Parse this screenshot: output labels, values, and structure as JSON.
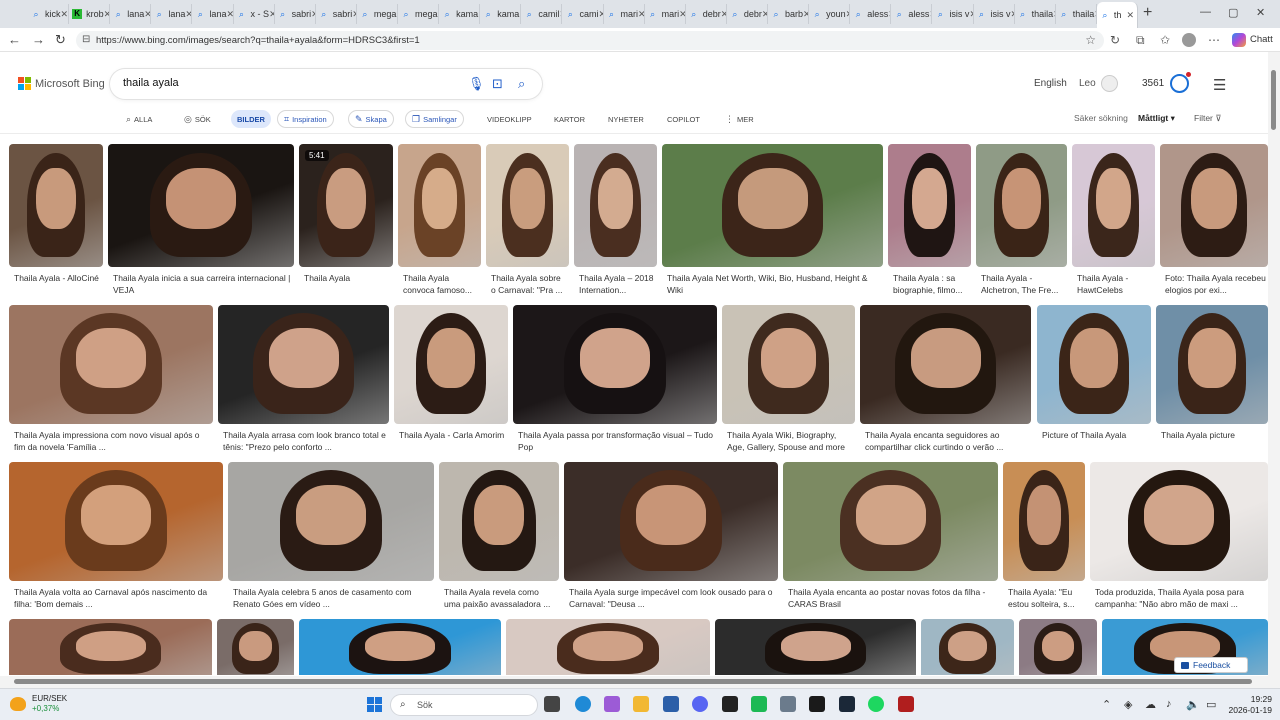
{
  "browser": {
    "tabs": [
      {
        "label": "kick",
        "fav": "search-icon"
      },
      {
        "label": "krob",
        "fav": "k-icon"
      },
      {
        "label": "lana",
        "fav": "search-icon"
      },
      {
        "label": "lana",
        "fav": "search-icon"
      },
      {
        "label": "lana",
        "fav": "search-icon"
      },
      {
        "label": "x - S",
        "fav": "search-icon"
      },
      {
        "label": "sabri",
        "fav": "search-icon"
      },
      {
        "label": "sabri",
        "fav": "search-icon"
      },
      {
        "label": "mega",
        "fav": "search-icon"
      },
      {
        "label": "mega",
        "fav": "search-icon"
      },
      {
        "label": "kama",
        "fav": "search-icon"
      },
      {
        "label": "kama",
        "fav": "search-icon"
      },
      {
        "label": "camil",
        "fav": "search-icon"
      },
      {
        "label": "cami",
        "fav": "search-icon"
      },
      {
        "label": "mari",
        "fav": "search-icon"
      },
      {
        "label": "mari",
        "fav": "search-icon"
      },
      {
        "label": "debr",
        "fav": "search-icon"
      },
      {
        "label": "debr",
        "fav": "search-icon"
      },
      {
        "label": "barb",
        "fav": "search-icon"
      },
      {
        "label": "youn",
        "fav": "search-icon"
      },
      {
        "label": "aless",
        "fav": "search-icon"
      },
      {
        "label": "aless",
        "fav": "search-icon"
      },
      {
        "label": "isis v",
        "fav": "search-icon"
      },
      {
        "label": "isis v",
        "fav": "search-icon"
      },
      {
        "label": "thaila",
        "fav": "search-icon"
      },
      {
        "label": "thaila",
        "fav": "search-icon"
      },
      {
        "label": "th",
        "fav": "search-icon",
        "active": true
      }
    ],
    "new_tab": "+",
    "url": "https://www.bing.com/images/search?q=thaila+ayala&form=HDRSC3&first=1",
    "chat_label": "Chatt"
  },
  "bing": {
    "logo_text": "Microsoft Bing",
    "query": "thaila ayala",
    "language": "English",
    "user_name": "Leo",
    "points": "3561",
    "scopes": [
      {
        "label": "ALLA",
        "icon": "search-icon",
        "style": "plain"
      },
      {
        "label": "SÖK",
        "icon": "copilot-icon",
        "style": "plain"
      },
      {
        "label": "BILDER",
        "icon": "",
        "style": "active"
      },
      {
        "label": "Inspiration",
        "icon": "inspiration-icon",
        "style": "pill"
      },
      {
        "label": "Skapa",
        "icon": "create-icon",
        "style": "pill"
      },
      {
        "label": "Samlingar",
        "icon": "collections-icon",
        "style": "pill"
      },
      {
        "label": "VIDEOKLIPP",
        "icon": "",
        "style": "plain"
      },
      {
        "label": "KARTOR",
        "icon": "",
        "style": "plain"
      },
      {
        "label": "NYHETER",
        "icon": "",
        "style": "plain"
      },
      {
        "label": "COPILOT",
        "icon": "",
        "style": "plain"
      },
      {
        "label": "MER",
        "icon": "more-icon",
        "style": "plain"
      }
    ],
    "safe_search_label": "Säker sökning",
    "safe_search_value": "Måttligt",
    "filter_label": "Filter"
  },
  "results": [
    {
      "caption": "Thaila Ayala - AlloCiné",
      "bg": "#6b5443",
      "skin": "#c89a7c",
      "hair": "#3a2418"
    },
    {
      "caption": "Thaila Ayala inicia a sua carreira internacional | VEJA",
      "bg": "#1a1512",
      "skin": "#c59275",
      "hair": "#2a1a12"
    },
    {
      "caption": "Thaila Ayala",
      "bg": "#2b221d",
      "skin": "#c99c80",
      "hair": "#3b2419",
      "badge": "5:41"
    },
    {
      "caption": "Thaila Ayala convoca famoso...",
      "bg": "#c7a58c",
      "skin": "#d6ac8a",
      "hair": "#6a4226"
    },
    {
      "caption": "Thaila Ayala sobre o Carnaval: \"Pra ...",
      "bg": "#d9cbb8",
      "skin": "#c99d7e",
      "hair": "#4b2f1f"
    },
    {
      "caption": "Thaila Ayala – 2018 Internation...",
      "bg": "#b9b3b3",
      "skin": "#d3ab90",
      "hair": "#4a2e20"
    },
    {
      "caption": "Thaila Ayala Net Worth, Wiki, Bio, Husband, Height & Wiki",
      "bg": "#5c7d4a",
      "skin": "#c59a7c",
      "hair": "#3c2519"
    },
    {
      "caption": "Thaila Ayala : sa biographie, filmo...",
      "bg": "#ad7d8c",
      "skin": "#d4a890",
      "hair": "#1f1513"
    },
    {
      "caption": "Thaila Ayala - Alchetron, The Fre...",
      "bg": "#8f9b86",
      "skin": "#c79476",
      "hair": "#3a2417"
    },
    {
      "caption": "Thaila Ayala - HawtCelebs",
      "bg": "#d7c8d6",
      "skin": "#d2a68a",
      "hair": "#3b261b"
    },
    {
      "caption": "Foto: Thaila Ayala recebeu elogios por exi...",
      "bg": "#b0968a",
      "skin": "#c89a7d",
      "hair": "#2d1c14"
    },
    {
      "caption": "Thaila Ayala impressiona com novo visual após o fim da novela 'Família ...",
      "bg": "#9c7561",
      "skin": "#cfa085",
      "hair": "#5b3724"
    },
    {
      "caption": "Thaila Ayala arrasa com look branco total e tênis: \"Prezo pelo conforto ...",
      "bg": "#252525",
      "skin": "#cfa28a",
      "hair": "#3a241a"
    },
    {
      "caption": "Thaila Ayala - Carla Amorim",
      "bg": "#ddd6d0",
      "skin": "#c99b7d",
      "hair": "#2c1c15"
    },
    {
      "caption": "Thaila Ayala passa por transformação visual – Tudo Pop",
      "bg": "#1c1718",
      "skin": "#d0a38b",
      "hair": "#161112"
    },
    {
      "caption": "Thaila Ayala Wiki, Biography, Age, Gallery, Spouse and more",
      "bg": "#c9c2b6",
      "skin": "#cfa186",
      "hair": "#3f2a1e"
    },
    {
      "caption": "Thaila Ayala encanta seguidores ao compartilhar click curtindo o verão ...",
      "bg": "#3a2a22",
      "skin": "#c89b80",
      "hair": "#22170f"
    },
    {
      "caption": "Picture of Thaila Ayala",
      "bg": "#8eb5cf",
      "skin": "#c8987a",
      "hair": "#3b2518"
    },
    {
      "caption": "Thaila Ayala picture",
      "bg": "#6f8fa7",
      "skin": "#cc9c7e",
      "hair": "#3a2418"
    },
    {
      "caption": "Thaila Ayala volta ao Carnaval após nascimento da filha: 'Bom demais ...",
      "bg": "#b5652e",
      "skin": "#d3a07c",
      "hair": "#6a3b1c"
    },
    {
      "caption": "Thaila Ayala celebra 5 anos de casamento com Renato Góes em vídeo ...",
      "bg": "#a7a6a3",
      "skin": "#c99d80",
      "hair": "#2a1b14"
    },
    {
      "caption": "Thaila Ayala revela como uma paixão avassaladora ...",
      "bg": "#bdb7ae",
      "skin": "#c99b7d",
      "hair": "#241812"
    },
    {
      "caption": "Thaila Ayala surge impecável com look ousado para o Carnaval: \"Deusa ...",
      "bg": "#3b2d28",
      "skin": "#c89577",
      "hair": "#4a2b1b"
    },
    {
      "caption": "Thaila Ayala encanta ao postar novas fotos da filha - CARAS Brasil",
      "bg": "#7c8a62",
      "skin": "#d1a487",
      "hair": "#4b3022"
    },
    {
      "caption": "Thaila Ayala: \"Eu estou solteira, s...",
      "bg": "#c88e55",
      "skin": "#c49274",
      "hair": "#3a2418"
    },
    {
      "caption": "Toda produzida, Thaila Ayala posa para campanha: \"Não abro mão de maxi ...",
      "bg": "#ece8e6",
      "skin": "#d1a58b",
      "hair": "#24170f"
    },
    {
      "caption": "",
      "bg": "#9b6c58",
      "skin": "#cf9f84",
      "hair": "#4a2c1e"
    },
    {
      "caption": "",
      "bg": "#7a6c68",
      "skin": "#c99a7f",
      "hair": "#3a2419"
    },
    {
      "caption": "",
      "bg": "#2e97d6",
      "skin": "#cf9f83",
      "hair": "#1c1311"
    },
    {
      "caption": "",
      "bg": "#d8c9c2",
      "skin": "#cfa187",
      "hair": "#4a2c1d"
    },
    {
      "caption": "",
      "bg": "#2c2c2c",
      "skin": "#cfa38c",
      "hair": "#1a120e"
    },
    {
      "caption": "",
      "bg": "#9fb7c4",
      "skin": "#cda086",
      "hair": "#3d2619"
    },
    {
      "caption": "",
      "bg": "#8c7b84",
      "skin": "#cc9d82",
      "hair": "#2b1c15"
    },
    {
      "caption": "",
      "bg": "#3a9bd4",
      "skin": "#c89678",
      "hair": "#1f1510"
    }
  ],
  "feedback_label": "Feedback",
  "taskbar": {
    "ticker_name": "EUR/SEK",
    "ticker_change": "+0,37%",
    "search_placeholder": "Sök",
    "time": "19:29",
    "date": "2026-01-19",
    "apps": [
      {
        "name": "task-view-icon",
        "color": "#444444"
      },
      {
        "name": "edge-icon",
        "color": "#1f8ad6"
      },
      {
        "name": "copilot-app-icon",
        "color": "#9c5bd6"
      },
      {
        "name": "file-explorer-icon",
        "color": "#f2b833"
      },
      {
        "name": "store-icon",
        "color": "#2c5fa8"
      },
      {
        "name": "discord-icon",
        "color": "#5865f2"
      },
      {
        "name": "app-black-icon",
        "color": "#222222"
      },
      {
        "name": "app-green-icon",
        "color": "#1db954"
      },
      {
        "name": "settings-icon",
        "color": "#6b7b8c"
      },
      {
        "name": "game-icon",
        "color": "#1a1a1a"
      },
      {
        "name": "steam-icon",
        "color": "#1b2838"
      },
      {
        "name": "spotify-icon",
        "color": "#1ed760"
      },
      {
        "name": "shield-app-icon",
        "color": "#b01e1e"
      }
    ]
  }
}
